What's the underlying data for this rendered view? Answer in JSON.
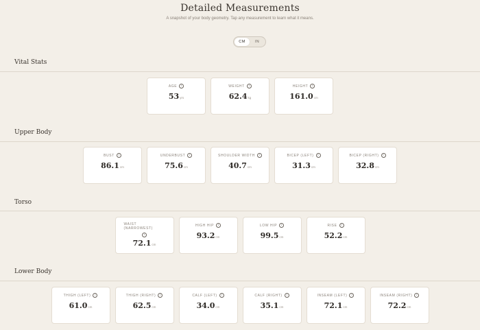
{
  "header": {
    "title": "Detailed Measurements",
    "subtitle": "A snapshot of your body geometry. Tap any measurement to learn what it means."
  },
  "unit_toggle": {
    "options": [
      "CM",
      "IN"
    ],
    "selected": "CM"
  },
  "sections": {
    "vital": {
      "title": "Vital Stats",
      "cards": [
        {
          "label": "AGE",
          "value": "53",
          "unit": "yrs"
        },
        {
          "label": "WEIGHT",
          "value": "62.4",
          "unit": "kg"
        },
        {
          "label": "HEIGHT",
          "value": "161.0",
          "unit": "cm"
        }
      ]
    },
    "upper": {
      "title": "Upper Body",
      "cards": [
        {
          "label": "BUST",
          "value": "86.1",
          "unit": "cm"
        },
        {
          "label": "UNDERBUST",
          "value": "75.6",
          "unit": "cm"
        },
        {
          "label": "SHOULDER WIDTH",
          "value": "40.7",
          "unit": "cm"
        },
        {
          "label": "BICEP (LEFT)",
          "value": "31.3",
          "unit": "cm"
        },
        {
          "label": "BICEP (RIGHT)",
          "value": "32.8",
          "unit": "cm"
        }
      ]
    },
    "torso": {
      "title": "Torso",
      "cards": [
        {
          "label": "WAIST (NARROWEST)",
          "value": "72.1",
          "unit": "cm"
        },
        {
          "label": "HIGH HIP",
          "value": "93.2",
          "unit": "cm"
        },
        {
          "label": "LOW HIP",
          "value": "99.5",
          "unit": "cm"
        },
        {
          "label": "RISE",
          "value": "52.2",
          "unit": "cm"
        }
      ]
    },
    "lower": {
      "title": "Lower Body",
      "cards": [
        {
          "label": "THIGH (LEFT)",
          "value": "61.0",
          "unit": "cm"
        },
        {
          "label": "THIGH (RIGHT)",
          "value": "62.5",
          "unit": "cm"
        },
        {
          "label": "CALF (LEFT)",
          "value": "34.0",
          "unit": "cm"
        },
        {
          "label": "CALF (RIGHT)",
          "value": "35.1",
          "unit": "cm"
        },
        {
          "label": "INSEAM (LEFT)",
          "value": "72.1",
          "unit": "cm"
        },
        {
          "label": "INSEAM (RIGHT)",
          "value": "72.2",
          "unit": "cm"
        }
      ]
    }
  },
  "info_icon_glyph": "i"
}
